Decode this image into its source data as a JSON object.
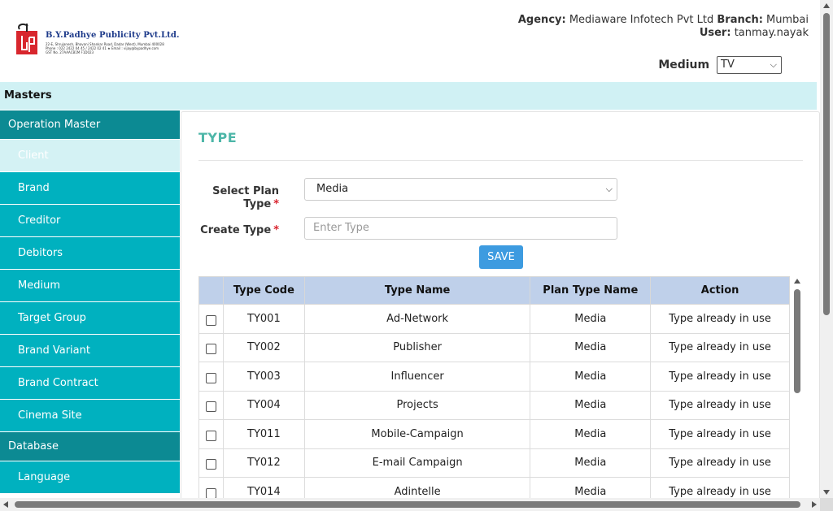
{
  "header": {
    "logo": {
      "name": "B.Y.Padhye Publicity Pvt.Ltd.",
      "line1": "22-E, Shrujanesh, Bhavani Shankar Road, Dadar (West), Mumbai 400028",
      "line2": "Phone : 022 2422 04 45 / 2422 02 41 ★ Email : vijay@bypadhye.com",
      "line3": "GST No. 27AAACB1M F1D023"
    },
    "agency_label": "Agency:",
    "agency_value": "Mediaware Infotech Pvt Ltd",
    "branch_label": "Branch:",
    "branch_value": "Mumbai",
    "user_label": "User:",
    "user_value": "tanmay.nayak",
    "medium_label": "Medium",
    "medium_value": "TV"
  },
  "masters_bar": "Masters",
  "sidebar": {
    "sections": [
      {
        "label": "Operation Master",
        "items": [
          "Client",
          "Brand",
          "Creditor",
          "Debitors",
          "Medium",
          "Target Group",
          "Brand Variant",
          "Brand Contract",
          "Cinema Site"
        ]
      },
      {
        "label": "Database",
        "items": [
          "Language"
        ]
      }
    ],
    "active_item": "Client"
  },
  "main": {
    "title": "TYPE",
    "select_plan_label": "Select Plan Type",
    "select_plan_value": "Media",
    "create_type_label": "Create Type",
    "create_type_placeholder": "Enter Type",
    "required_mark": "*",
    "save_label": "SAVE"
  },
  "table": {
    "columns": [
      "Type Code",
      "Type Name",
      "Plan Type Name",
      "Action"
    ],
    "rows": [
      {
        "code": "TY001",
        "name": "Ad-Network",
        "plan": "Media",
        "action": "Type already in use"
      },
      {
        "code": "TY002",
        "name": "Publisher",
        "plan": "Media",
        "action": "Type already in use"
      },
      {
        "code": "TY003",
        "name": "Influencer",
        "plan": "Media",
        "action": "Type already in use"
      },
      {
        "code": "TY004",
        "name": "Projects",
        "plan": "Media",
        "action": "Type already in use"
      },
      {
        "code": "TY011",
        "name": "Mobile-Campaign",
        "plan": "Media",
        "action": "Type already in use"
      },
      {
        "code": "TY012",
        "name": "E-mail Campaign",
        "plan": "Media",
        "action": "Type already in use"
      },
      {
        "code": "TY014",
        "name": "Adintelle",
        "plan": "Media",
        "action": "Type already in use"
      }
    ]
  },
  "colors": {
    "sidebar_section": "#0c8a93",
    "sidebar_item": "#00b1bf",
    "sidebar_active": "#d4f2f4",
    "masters_bar": "#d0f1f4",
    "title": "#4db6a8",
    "table_header": "#bfd0ea",
    "save_button": "#3d9be0",
    "required": "#d9232e"
  }
}
